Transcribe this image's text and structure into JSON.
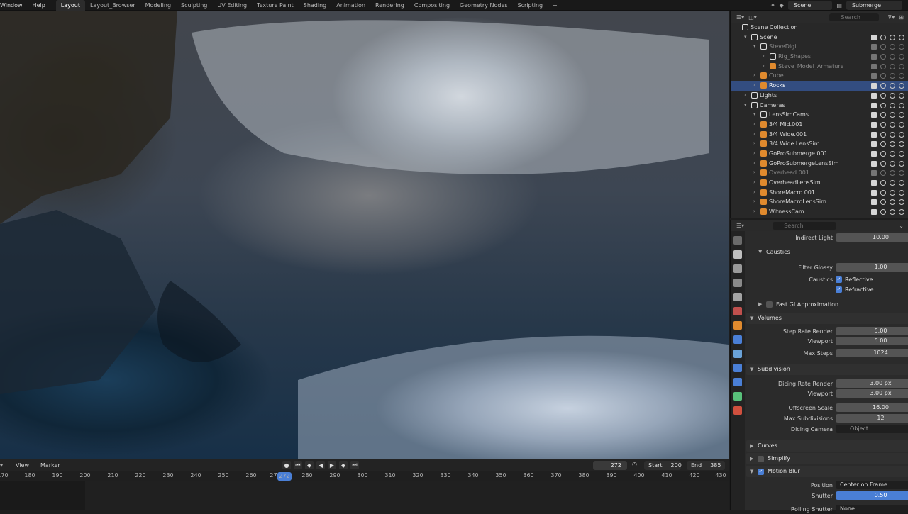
{
  "topbar": {
    "menus": [
      "Window",
      "Help"
    ],
    "workspaces": [
      "Layout",
      "Layout_Browser",
      "Modeling",
      "Sculpting",
      "UV Editing",
      "Texture Paint",
      "Shading",
      "Animation",
      "Rendering",
      "Compositing",
      "Geometry Nodes",
      "Scripting",
      "+"
    ],
    "active_workspace": "Layout",
    "scene": "Scene",
    "view_layer": "Submerge"
  },
  "timeline": {
    "menus": [
      "View",
      "Marker"
    ],
    "current_frame": "272",
    "start_label": "Start",
    "start": "200",
    "end_label": "End",
    "end": "385",
    "ticks": [
      "170",
      "180",
      "190",
      "200",
      "210",
      "220",
      "230",
      "240",
      "250",
      "260",
      "270",
      "272",
      "280",
      "290",
      "300",
      "310",
      "320",
      "330",
      "340",
      "350",
      "360",
      "370",
      "380",
      "390",
      "400",
      "410",
      "420",
      "430"
    ]
  },
  "outliner": {
    "search_placeholder": "Search",
    "rows": [
      {
        "label": "Scene Collection",
        "indent": 0,
        "icon": "collection-icon"
      },
      {
        "label": "Scene",
        "indent": 1,
        "icon": "collection-icon"
      },
      {
        "label": "SteveDigi",
        "indent": 2,
        "icon": "collection-icon",
        "dim": true
      },
      {
        "label": "Rig_Shapes",
        "indent": 3,
        "icon": "collection-icon",
        "dim": true
      },
      {
        "label": "Steve_Model_Armature",
        "indent": 3,
        "icon": "armature-icon",
        "dim": true
      },
      {
        "label": "Cube",
        "indent": 2,
        "icon": "mesh-icon",
        "dim": true
      },
      {
        "label": "Rocks",
        "indent": 2,
        "icon": "mesh-icon",
        "selected": true
      },
      {
        "label": "Lights",
        "indent": 1,
        "icon": "collection-icon"
      },
      {
        "label": "Cameras",
        "indent": 1,
        "icon": "collection-icon"
      },
      {
        "label": "LensSimCams",
        "indent": 2,
        "icon": "collection-icon"
      },
      {
        "label": "3/4 Mid.001",
        "indent": 2,
        "icon": "camera-icon"
      },
      {
        "label": "3/4 Wide.001",
        "indent": 2,
        "icon": "camera-icon"
      },
      {
        "label": "3/4 Wide LensSim",
        "indent": 2,
        "icon": "camera-icon"
      },
      {
        "label": "GoProSubmerge.001",
        "indent": 2,
        "icon": "camera-icon"
      },
      {
        "label": "GoProSubmergeLensSim",
        "indent": 2,
        "icon": "camera-icon"
      },
      {
        "label": "Overhead.001",
        "indent": 2,
        "icon": "camera-icon",
        "dim": true
      },
      {
        "label": "OverheadLensSim",
        "indent": 2,
        "icon": "camera-icon"
      },
      {
        "label": "ShoreMacro.001",
        "indent": 2,
        "icon": "camera-icon"
      },
      {
        "label": "ShoreMacroLensSim",
        "indent": 2,
        "icon": "camera-icon"
      },
      {
        "label": "WitnessCam",
        "indent": 2,
        "icon": "camera-icon"
      }
    ]
  },
  "properties": {
    "search_placeholder": "Search",
    "indirect_light_label": "Indirect Light",
    "indirect_light": "10.00",
    "caustics_panel": "Caustics",
    "filter_glossy_label": "Filter Glossy",
    "filter_glossy": "1.00",
    "caustics_label": "Caustics",
    "reflective": "Reflective",
    "refractive": "Refractive",
    "fast_gi": "Fast GI Approximation",
    "volumes_panel": "Volumes",
    "step_rate_render_label": "Step Rate Render",
    "step_rate_render": "5.00",
    "viewport_label": "Viewport",
    "step_viewport": "5.00",
    "max_steps_label": "Max Steps",
    "max_steps": "1024",
    "subdivision_panel": "Subdivision",
    "dicing_rate_render_label": "Dicing Rate Render",
    "dicing_rate_render": "3.00 px",
    "dicing_viewport": "3.00 px",
    "offscreen_scale_label": "Offscreen Scale",
    "offscreen_scale": "16.00",
    "max_subdivisions_label": "Max Subdivisions",
    "max_subdivisions": "12",
    "dicing_camera_label": "Dicing Camera",
    "dicing_camera_placeholder": "Object",
    "curves_panel": "Curves",
    "simplify_panel": "Simplify",
    "motion_blur_panel": "Motion Blur",
    "position_label": "Position",
    "position": "Center on Frame",
    "shutter_label": "Shutter",
    "shutter": "0.50",
    "rolling_shutter_label": "Rolling Shutter",
    "rolling_shutter": "None"
  },
  "colors": {
    "accent": "#4a7fd6",
    "selected_row": "#334d80"
  }
}
